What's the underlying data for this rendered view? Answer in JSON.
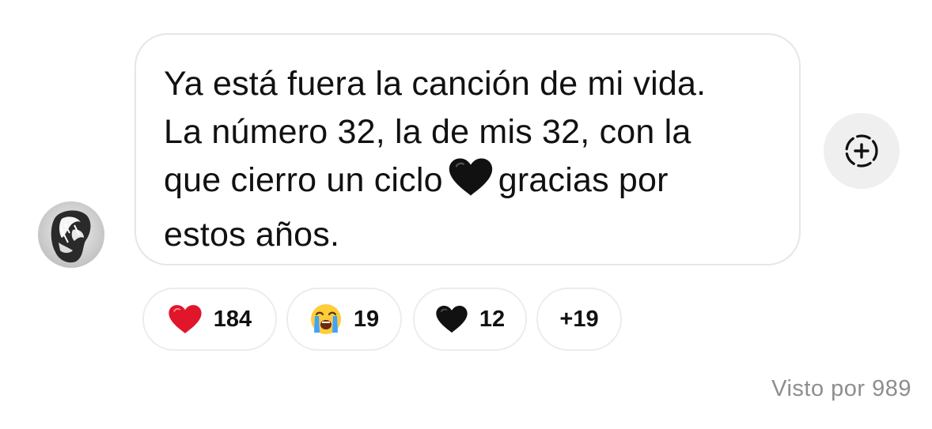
{
  "message": {
    "lines": [
      "Ya está fuera la canción de mi vida.",
      "La número 32, la de mis 32, con la",
      "que cierro un ciclo",
      "gracias por",
      "estos años."
    ],
    "inline_emoji": "black-heart-icon"
  },
  "reactions": [
    {
      "icon": "red-heart-icon",
      "count": "184"
    },
    {
      "icon": "loudly-crying-face-icon",
      "count": "19"
    },
    {
      "icon": "black-heart-icon",
      "count": "12"
    },
    {
      "icon": "",
      "count": "+19"
    }
  ],
  "footer": {
    "seen_text": "Visto por 989"
  },
  "colors": {
    "bubble_border": "#e6e6e6",
    "add_reaction_bg": "#efefef",
    "seen_text": "#8e8e8e",
    "red_heart": "#e0162b",
    "black_heart": "#111111"
  }
}
